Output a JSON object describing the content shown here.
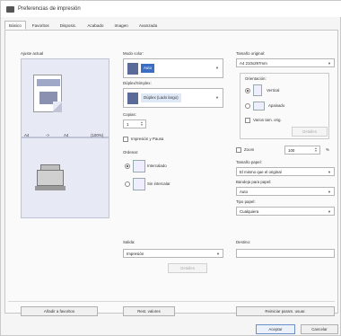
{
  "title": "Preferencias de impresión",
  "tabs": [
    "Básico",
    "Favoritos",
    "Disposic.",
    "Acabado",
    "Imagen",
    "Avanzada"
  ],
  "left": {
    "current_label": "Ajuste actual",
    "paper_from": "A4",
    "arrow": "->",
    "paper_to": "A4",
    "zoom_text": "(100%)"
  },
  "color_mode": {
    "label": "Modo color:",
    "value": "Auto"
  },
  "duplex": {
    "label": "Dúplex/Simplex:",
    "value": "Dúplex (Lado largo)"
  },
  "copies": {
    "label": "Copias:",
    "value": "1"
  },
  "print_pause_label": "Impresión y Pausa",
  "collate": {
    "label": "Ordenar:",
    "opt1": "Intercalado",
    "opt2": "Sin intercalar"
  },
  "original_size": {
    "label": "Tamaño original:",
    "value": "A4 210x297mm"
  },
  "orientation": {
    "label": "Orientación:",
    "vertical": "Vertical",
    "horizontal": "Apaisado"
  },
  "various_orig_label": "Varios tam. orig.",
  "detail_button": "Detalles",
  "zoom": {
    "label": "Zoom",
    "value": "100",
    "unit": "%"
  },
  "paper_size": {
    "label": "Tamaño papel:",
    "value": "El mismo que el original"
  },
  "paper_tray": {
    "label": "Bandeja para papel:",
    "value": "Auto"
  },
  "paper_type": {
    "label": "Tipo papel:",
    "value": "Cualquiera"
  },
  "output": {
    "label": "Salida:",
    "value": "Impresión",
    "detail": "Detalles"
  },
  "destination": {
    "label": "Destino:",
    "value": ""
  },
  "footer_buttons": {
    "add_favorites": "Añadir a favoritos",
    "restore": "Rest. valores",
    "reset_user": "Reiniciar param. usuar."
  },
  "dialog_buttons": {
    "accept": "Aceptar",
    "cancel": "Cancelar"
  }
}
